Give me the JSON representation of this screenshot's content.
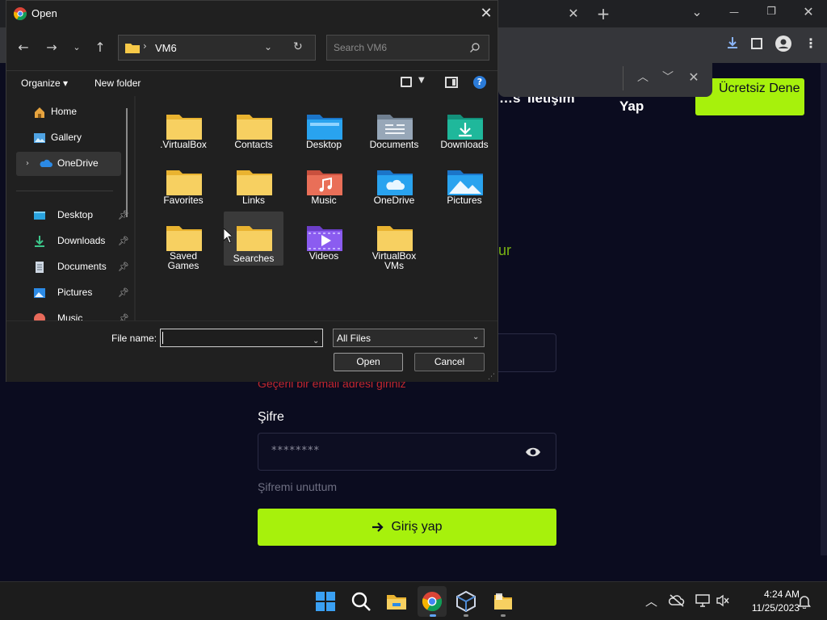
{
  "browser": {
    "close_tab": "✕",
    "new_tab": "+",
    "min": "—",
    "restore": "❐",
    "close": "✕",
    "chev": "⌄"
  },
  "page": {
    "nav_items": [
      "…s",
      "İletişim"
    ],
    "nav_yap": "Yap",
    "cta_label": "Ücretsiz Dene",
    "accent_text": "ur",
    "email_error": "Geçerli bir email adresi giriniz",
    "password_label": "Şifre",
    "password_value": "********",
    "forgot": "Şifremi unuttum",
    "login_label": "Giriş yap"
  },
  "dialog": {
    "title": "Open",
    "address": "VM6",
    "search_placeholder": "Search VM6",
    "organize": "Organize ▾",
    "new_folder": "New folder",
    "help": "?",
    "nav": [
      {
        "label": "Home"
      },
      {
        "label": "Gallery"
      },
      {
        "label": "OneDrive"
      },
      {
        "label": "Desktop"
      },
      {
        "label": "Downloads"
      },
      {
        "label": "Documents"
      },
      {
        "label": "Pictures"
      },
      {
        "label": "Music"
      }
    ],
    "items": [
      {
        "label": ".VirtualBox"
      },
      {
        "label": "Contacts"
      },
      {
        "label": "Desktop"
      },
      {
        "label": "Documents"
      },
      {
        "label": "Downloads"
      },
      {
        "label": "Favorites"
      },
      {
        "label": "Links"
      },
      {
        "label": "Music"
      },
      {
        "label": "OneDrive"
      },
      {
        "label": "Pictures"
      },
      {
        "label": "Saved Games"
      },
      {
        "label": "Searches"
      },
      {
        "label": "Videos"
      },
      {
        "label": "VirtualBox VMs"
      }
    ],
    "filename_label": "File name:",
    "filename_value": "",
    "filter": "All Files",
    "open": "Open",
    "cancel": "Cancel"
  },
  "taskbar": {
    "time": "4:24 AM",
    "date": "11/25/2023"
  },
  "colors": {
    "accent_green": "#a7f10c",
    "folder_yellow": "#f7c948",
    "dialog_bg": "#202020"
  }
}
